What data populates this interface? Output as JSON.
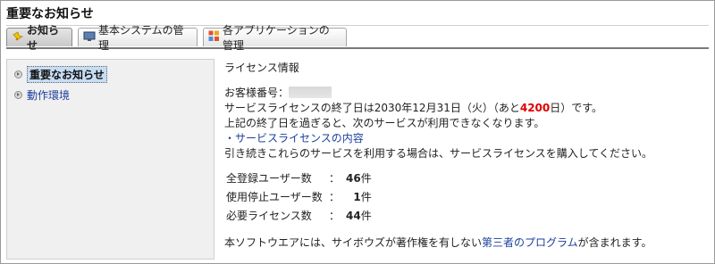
{
  "page": {
    "title": "重要なお知らせ"
  },
  "tabs": [
    {
      "label": "お知らせ",
      "icon": "bell-icon",
      "active": true
    },
    {
      "label": "基本システムの管理",
      "icon": "monitor-icon",
      "active": false
    },
    {
      "label": "各アプリケーションの管理",
      "icon": "apps-grid-icon",
      "active": false
    }
  ],
  "sidebar": {
    "items": [
      {
        "label": "重要なお知らせ",
        "selected": true
      },
      {
        "label": "動作環境",
        "selected": false
      }
    ]
  },
  "license": {
    "heading": "ライセンス情報",
    "customer_number_label": "お客様番号：",
    "expiry_prefix": "サービスライセンスの終了日は2030年12月31日（火）（あと",
    "days_left": "4200",
    "expiry_suffix": "日）です。",
    "warning": "上記の終了日を過ぎると、次のサービスが利用できなくなります。",
    "service_link": "・サービスライセンスの内容",
    "purchase_note": "引き続きこれらのサービスを利用する場合は、サービスライセンスを購入してください。",
    "stats": [
      {
        "label": "全登録ユーザー数",
        "colon": "：",
        "value": "46",
        "unit": "件"
      },
      {
        "label": "使用停止ユーザー数",
        "colon": "：",
        "value": "1",
        "unit": "件"
      },
      {
        "label": "必要ライセンス数",
        "colon": "：",
        "value": "44",
        "unit": "件"
      }
    ],
    "thirdparty_prefix": "本ソフトウエアには、サイボウズが著作権を有しない",
    "thirdparty_link": "第三者のプログラム",
    "thirdparty_suffix": "が含まれます。"
  },
  "colors": {
    "link": "#1a3f9c",
    "days_left": "#e00000",
    "sidebar_bg": "#f0f0f0"
  }
}
